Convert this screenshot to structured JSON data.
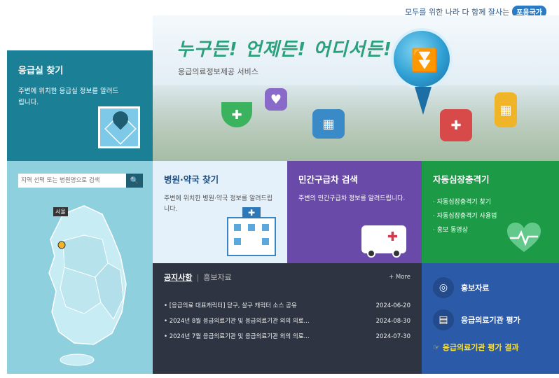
{
  "top": {
    "slogan": "모두를 위한 나라 다 함께 잘사는",
    "badge": "포용국가"
  },
  "hero": {
    "slogan": "누구든! 언제든! 어디서든!",
    "service": "응급의료정보제공 서비스"
  },
  "emergency": {
    "title": "응급실 찾기",
    "desc": "주변에 위치한 응급실 정보를 알려드립니다."
  },
  "search": {
    "placeholder": "지역 선택 또는 병원명으로 검색",
    "button_icon": "search-icon",
    "map_label": "서울"
  },
  "hospital": {
    "title": "병원·약국 찾기",
    "desc": "주변에 위치한 병원·약국 정보를 알려드립니다."
  },
  "ambulance": {
    "title": "민간구급차 검색",
    "desc": "주변의 민간구급차 정보를 알려드립니다."
  },
  "aed": {
    "title": "자동심장충격기",
    "items": [
      "자동심장충격기 찾기",
      "자동심장충격기 사용법",
      "홍보 동영상"
    ]
  },
  "notice": {
    "tab_active": "공지사항",
    "tab_other": "홍보자료",
    "more": "+ More",
    "items": [
      {
        "title": "[응급의료 대표캐릭터] 닫구, 살구 캐릭터 소스 공유",
        "date": "2024-06-20"
      },
      {
        "title": "2024년 8월 응급의료기관 및 응급의료기관 외의 의료...",
        "date": "2024-08-30"
      },
      {
        "title": "2024년 7월 응급의료기관 및 응급의료기관 외의 의료...",
        "date": "2024-07-30"
      }
    ]
  },
  "promo": {
    "item1": "홍보자료",
    "item2": "응급의료기관 평가",
    "result": "응급의료기관 평가 결과"
  },
  "colors": {
    "teal": "#1b7f96",
    "purple": "#6a4aa8",
    "green": "#1c9a46",
    "navy": "#2a5aa8",
    "dark": "#2e3442"
  }
}
